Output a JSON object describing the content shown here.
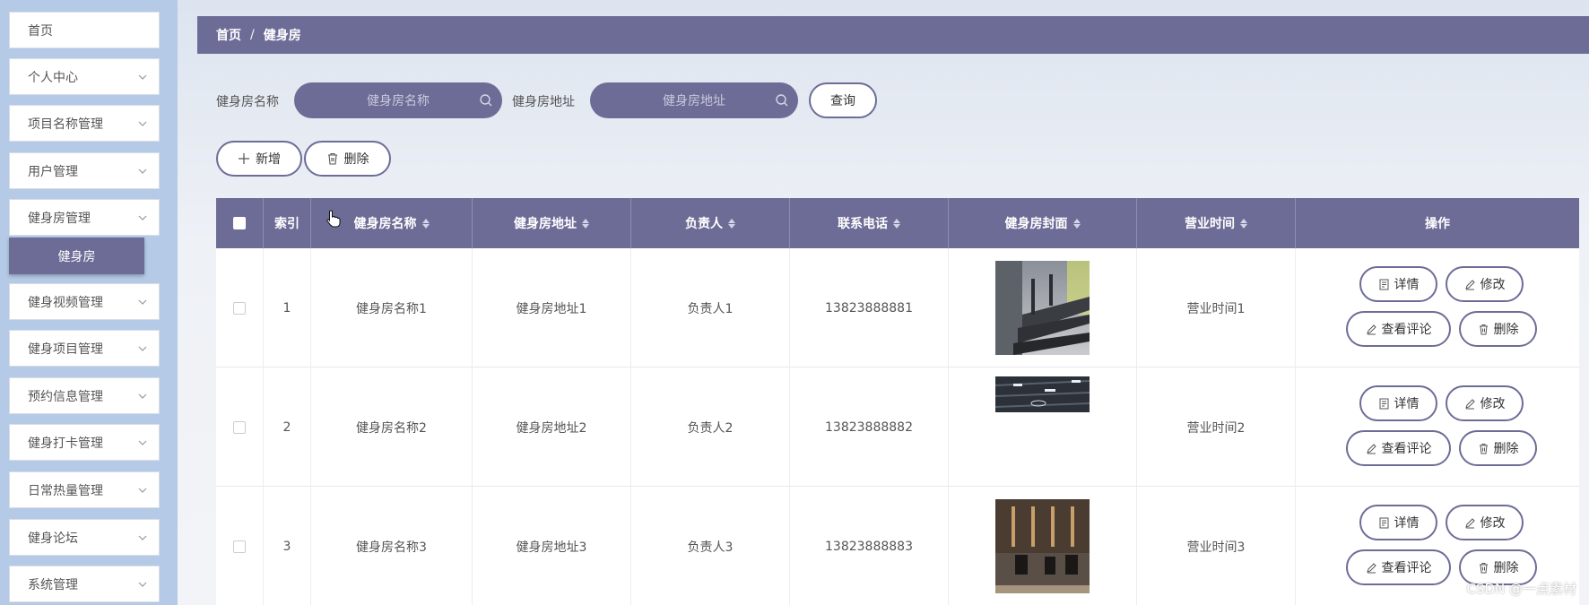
{
  "sidebar": {
    "items": [
      {
        "label": "首页",
        "has_children": false
      },
      {
        "label": "个人中心",
        "has_children": true
      },
      {
        "label": "项目名称管理",
        "has_children": true
      },
      {
        "label": "用户管理",
        "has_children": true
      },
      {
        "label": "健身房管理",
        "has_children": true
      },
      {
        "label": "健身视频管理",
        "has_children": true
      },
      {
        "label": "健身项目管理",
        "has_children": true
      },
      {
        "label": "预约信息管理",
        "has_children": true
      },
      {
        "label": "健身打卡管理",
        "has_children": true
      },
      {
        "label": "日常热量管理",
        "has_children": true
      },
      {
        "label": "健身论坛",
        "has_children": true
      },
      {
        "label": "系统管理",
        "has_children": true
      }
    ],
    "active_sub_item": "健身房"
  },
  "breadcrumb": {
    "home": "首页",
    "separator": "/",
    "current": "健身房"
  },
  "search": {
    "name_label": "健身房名称",
    "name_placeholder": "健身房名称",
    "address_label": "健身房地址",
    "address_placeholder": "健身房地址",
    "query_button": "查询"
  },
  "actions": {
    "add_label": "新增",
    "delete_label": "删除"
  },
  "table": {
    "headers": {
      "index": "索引",
      "name": "健身房名称",
      "address": "健身房地址",
      "owner": "负责人",
      "phone": "联系电话",
      "cover": "健身房封面",
      "hours": "营业时间",
      "ops": "操作"
    },
    "rows": [
      {
        "index": "1",
        "name": "健身房名称1",
        "address": "健身房地址1",
        "owner": "负责人1",
        "phone": "13823888881",
        "hours": "营业时间1",
        "cover": "treadmill-row-image"
      },
      {
        "index": "2",
        "name": "健身房名称2",
        "address": "健身房地址2",
        "owner": "负责人2",
        "phone": "13823888882",
        "hours": "营业时间2",
        "cover": "gym-ceiling-image"
      },
      {
        "index": "3",
        "name": "健身房名称3",
        "address": "健身房地址3",
        "owner": "负责人3",
        "phone": "13823888883",
        "hours": "营业时间3",
        "cover": "dark-gym-room-image"
      }
    ],
    "row_actions": {
      "detail": "详情",
      "edit": "修改",
      "comments": "查看评论",
      "delete": "删除"
    }
  },
  "watermark": "CSDN @一点素材",
  "colors": {
    "accent": "#6d6c97",
    "sidebar_bg": "#b4cae6"
  }
}
